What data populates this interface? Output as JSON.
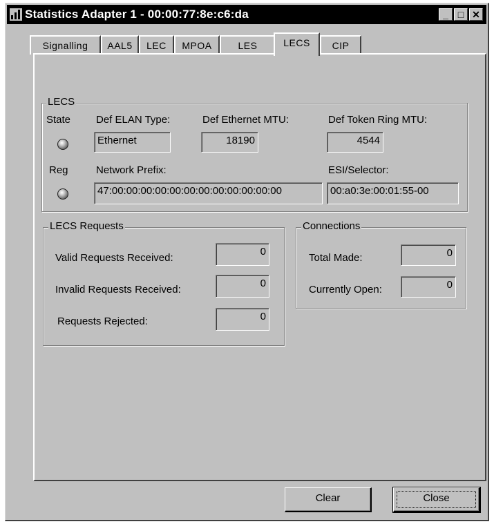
{
  "window": {
    "title": "Statistics Adapter 1 - 00:00:77:8e:c6:da"
  },
  "titlebar_buttons": {
    "minimize": "_",
    "maximize": "□",
    "close": "✕"
  },
  "tabs": [
    {
      "label": "Signalling"
    },
    {
      "label": "AAL5"
    },
    {
      "label": "LEC"
    },
    {
      "label": "MPOA"
    },
    {
      "label": "LES"
    },
    {
      "label": "LECS"
    },
    {
      "label": "CIP"
    }
  ],
  "active_tab": "LECS",
  "lecs_group": {
    "legend": "LECS",
    "state_label": "State",
    "reg_label": "Reg",
    "def_elan_type_label": "Def ELAN Type:",
    "def_elan_type_value": "Ethernet",
    "def_ethernet_mtu_label": "Def Ethernet MTU:",
    "def_ethernet_mtu_value": "18190",
    "def_token_ring_mtu_label": "Def Token Ring MTU:",
    "def_token_ring_mtu_value": "4544",
    "network_prefix_label": "Network Prefix:",
    "network_prefix_value": "47:00:00:00:00:00:00:00:00:00:00:00:00",
    "esi_selector_label": "ESI/Selector:",
    "esi_selector_value": "00:a0:3e:00:01:55-00"
  },
  "requests_group": {
    "legend": "LECS Requests",
    "valid_label": "Valid Requests Received:",
    "valid_value": "0",
    "invalid_label": "Invalid Requests Received:",
    "invalid_value": "0",
    "rejected_label": "Requests Rejected:",
    "rejected_value": "0"
  },
  "connections_group": {
    "legend": "Connections",
    "total_made_label": "Total Made:",
    "total_made_value": "0",
    "currently_open_label": "Currently Open:",
    "currently_open_value": "0"
  },
  "buttons": {
    "clear": "Clear",
    "close": "Close"
  }
}
